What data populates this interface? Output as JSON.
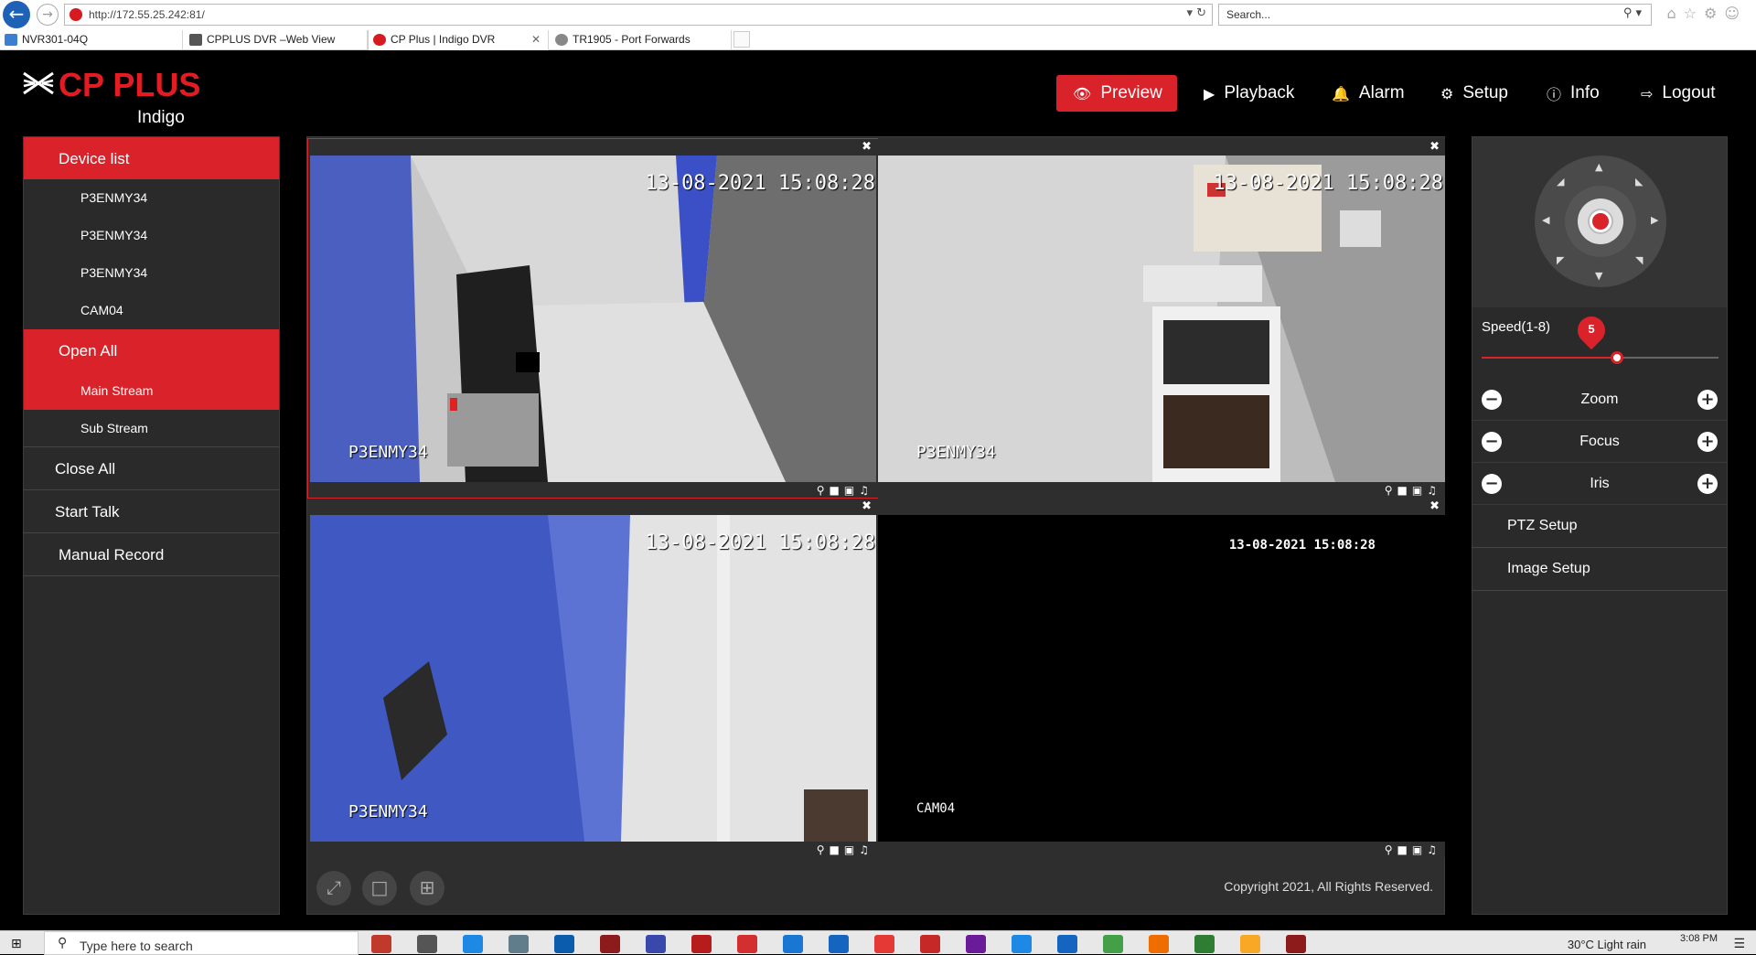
{
  "browser": {
    "url": "http://172.55.25.242:81/",
    "search_placeholder": "Search...",
    "tabs": [
      {
        "label": "NVR301-04Q",
        "icon": "nvr-tab-icon"
      },
      {
        "label": "CPPLUS DVR –Web View",
        "icon": "cpplus-tab-icon"
      },
      {
        "label": "CP Plus | Indigo DVR",
        "icon": "cpplus-red-tab-icon"
      },
      {
        "label": "TR1905 - Port Forwards",
        "icon": "router-tab-icon"
      }
    ]
  },
  "header": {
    "brand": "CP PLUS",
    "sub": "Indigo",
    "nav": {
      "preview": "Preview",
      "playback": "Playback",
      "alarm": "Alarm",
      "setup": "Setup",
      "info": "Info",
      "logout": "Logout"
    }
  },
  "sidebar": {
    "device_list": "Device list",
    "devices": [
      "P3ENMY34",
      "P3ENMY34",
      "P3ENMY34",
      "CAM04"
    ],
    "open_all": "Open All",
    "main_stream": "Main Stream",
    "sub_stream": "Sub Stream",
    "close_all": "Close All",
    "start_talk": "Start Talk",
    "manual_record": "Manual Record"
  },
  "video": {
    "windows": [
      {
        "time": "13-08-2021 15:08:28",
        "cam": "P3ENMY34"
      },
      {
        "time": "13-08-2021 15:08:28",
        "cam": "P3ENMY34"
      },
      {
        "time": "13-08-2021 15:08:28",
        "cam": "P3ENMY34"
      },
      {
        "time": "13-08-2021 15:08:28",
        "cam": "CAM04"
      }
    ],
    "copyright": "Copyright 2021, All Rights Reserved."
  },
  "ptz": {
    "speed_label": "Speed(1-8)",
    "speed_value": "5",
    "speed_fraction": 0.57,
    "zoom": "Zoom",
    "focus": "Focus",
    "iris": "Iris",
    "ptz_setup": "PTZ Setup",
    "image_setup": "Image Setup"
  },
  "taskbar": {
    "search_placeholder": "Type here to search",
    "weather": "30°C  Light rain",
    "time": "3:08 PM"
  },
  "colors": {
    "accent": "#d9222a",
    "panel": "#2a2a2a",
    "background": "#000000"
  }
}
